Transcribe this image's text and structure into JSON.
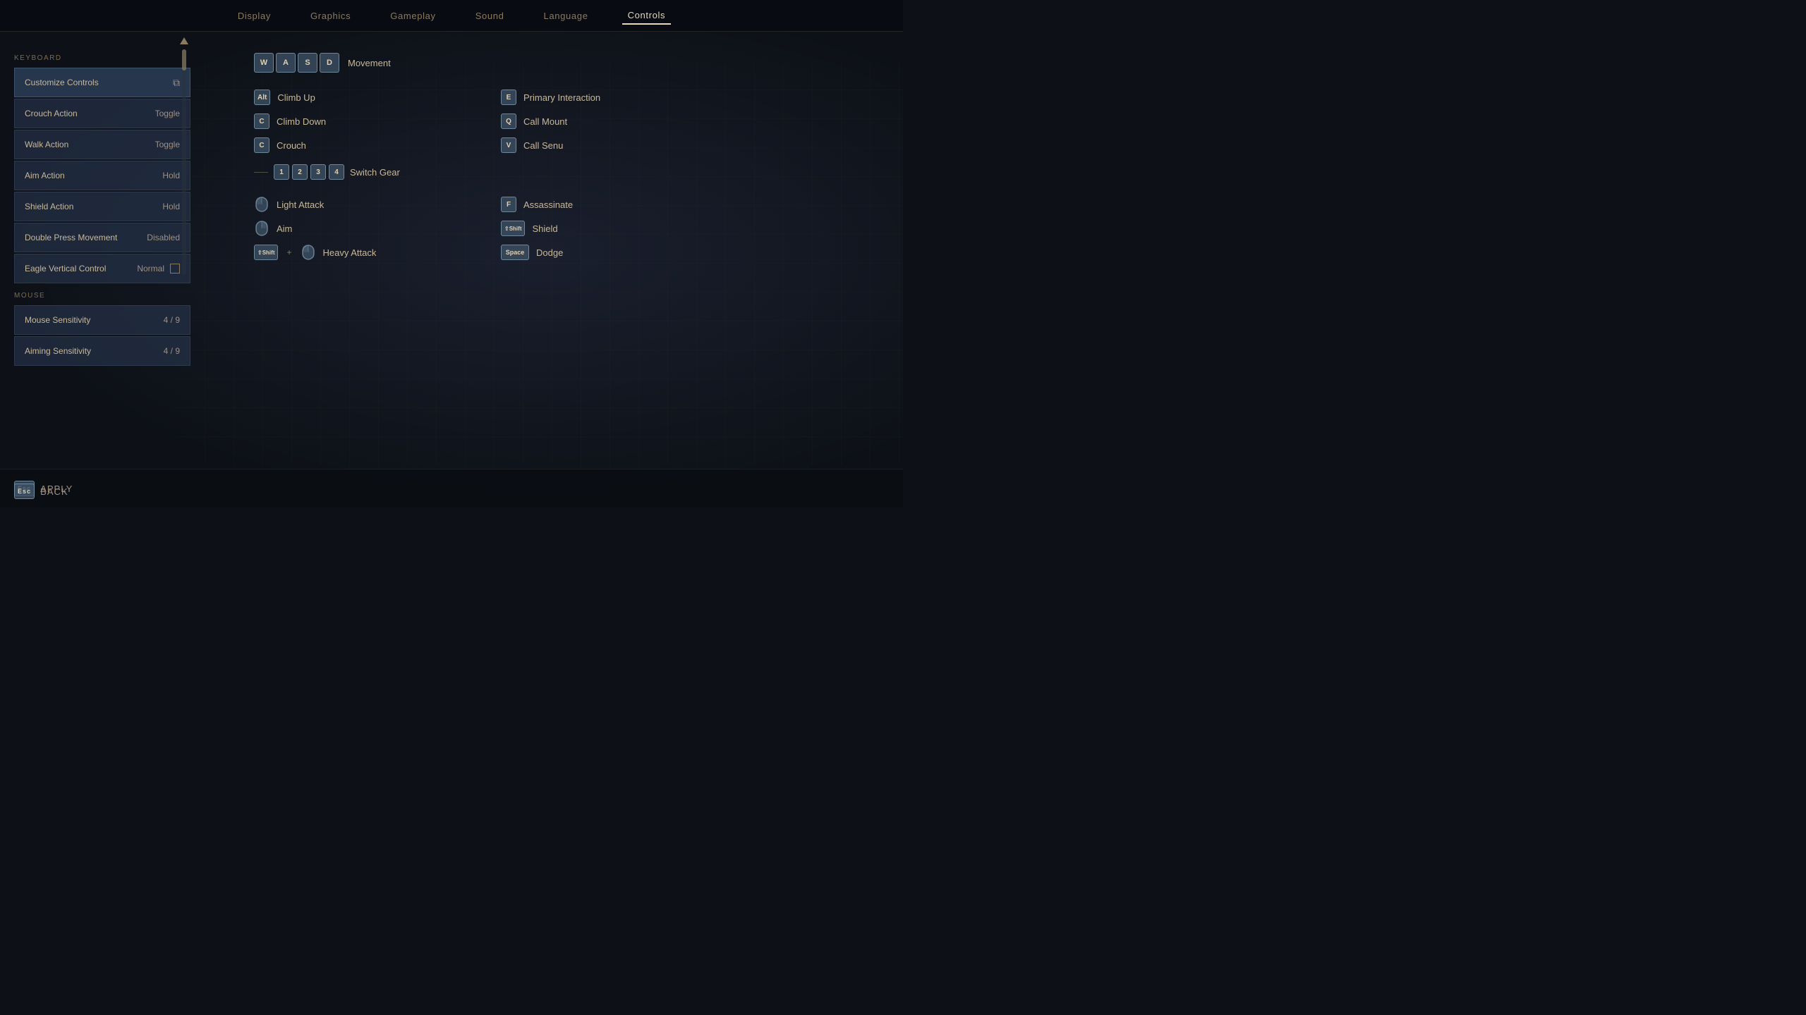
{
  "nav": {
    "items": [
      "Display",
      "Graphics",
      "Gameplay",
      "Sound",
      "Language",
      "Controls"
    ],
    "active": "Controls"
  },
  "left_panel": {
    "keyboard_label": "KEYBOARD",
    "mouse_label": "MOUSE",
    "items": [
      {
        "label": "Customize Controls",
        "value": "",
        "type": "header"
      },
      {
        "label": "Crouch Action",
        "value": "Toggle",
        "type": "setting"
      },
      {
        "label": "Walk Action",
        "value": "Toggle",
        "type": "setting"
      },
      {
        "label": "Aim Action",
        "value": "Hold",
        "type": "setting"
      },
      {
        "label": "Shield Action",
        "value": "Hold",
        "type": "setting"
      },
      {
        "label": "Double Press Movement",
        "value": "Disabled",
        "type": "setting"
      },
      {
        "label": "Eagle Vertical Control",
        "value": "Normal",
        "type": "setting-checkbox"
      }
    ],
    "mouse_items": [
      {
        "label": "Mouse Sensitivity",
        "value": "4 / 9",
        "type": "setting"
      },
      {
        "label": "Aiming Sensitivity",
        "value": "4 / 9",
        "type": "setting"
      }
    ]
  },
  "main": {
    "movement_label": "Movement",
    "wasd_keys": [
      "W",
      "A",
      "S",
      "D"
    ],
    "movement_controls_left": [
      {
        "key": "Alt",
        "label": "Climb Up"
      },
      {
        "key": "C",
        "label": "Climb Down"
      },
      {
        "key": "C",
        "label": "Crouch"
      }
    ],
    "movement_controls_right": [
      {
        "key": "E",
        "label": "Primary Interaction"
      },
      {
        "key": "Q",
        "label": "Call Mount"
      },
      {
        "key": "V",
        "label": "Call Senu"
      }
    ],
    "gear_keys": [
      "1",
      "2",
      "3",
      "4"
    ],
    "gear_label": "Switch Gear",
    "combat_left": [
      {
        "key": "lmb",
        "label": "Light Attack"
      },
      {
        "key": "rmb",
        "label": "Aim"
      },
      {
        "key": "shift+lmb",
        "label": "Heavy Attack"
      }
    ],
    "combat_right": [
      {
        "key": "F",
        "label": "Assassinate"
      },
      {
        "key": "Shift",
        "label": "Shield"
      },
      {
        "key": "Space",
        "label": "Dodge"
      }
    ]
  },
  "bottom": {
    "apply_label": "APPLY",
    "apply_key": "Esc",
    "back_label": "BACK",
    "back_key": "Esc"
  }
}
